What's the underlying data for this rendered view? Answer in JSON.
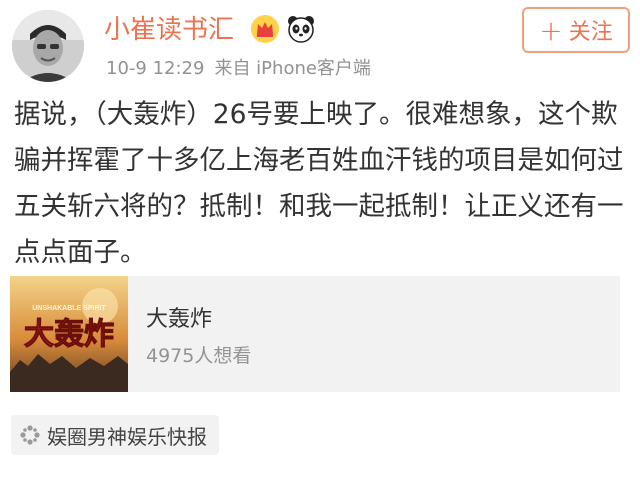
{
  "user": {
    "name": "小崔读书汇",
    "avatar_icon": "user-avatar-icon",
    "badges": [
      "crown-icon",
      "panda-icon"
    ]
  },
  "meta": {
    "time": "10-9 12:29",
    "source": "来自 iPhone客户端"
  },
  "follow_button": {
    "plus": "+",
    "label": "关注"
  },
  "post": {
    "text": "据说，（大轰炸）26号要上映了。很难想象，这个欺骗并挥霍了十多亿上海老百姓血汗钱的项目是如何过五关斩六将的？抵制！和我一起抵制！让正义还有一点点面子。"
  },
  "movie_card": {
    "poster_tagline": "UNSHAKABLE SPIRIT",
    "poster_title": "大轰炸",
    "title": "大轰炸",
    "subtitle": "4975人想看"
  },
  "topic": {
    "icon": "supertopic-icon",
    "label": "娱圈男神娱乐快报"
  },
  "colors": {
    "accent": "#eb7350",
    "meta_gray": "#929292",
    "card_bg": "#f2f2f2"
  }
}
